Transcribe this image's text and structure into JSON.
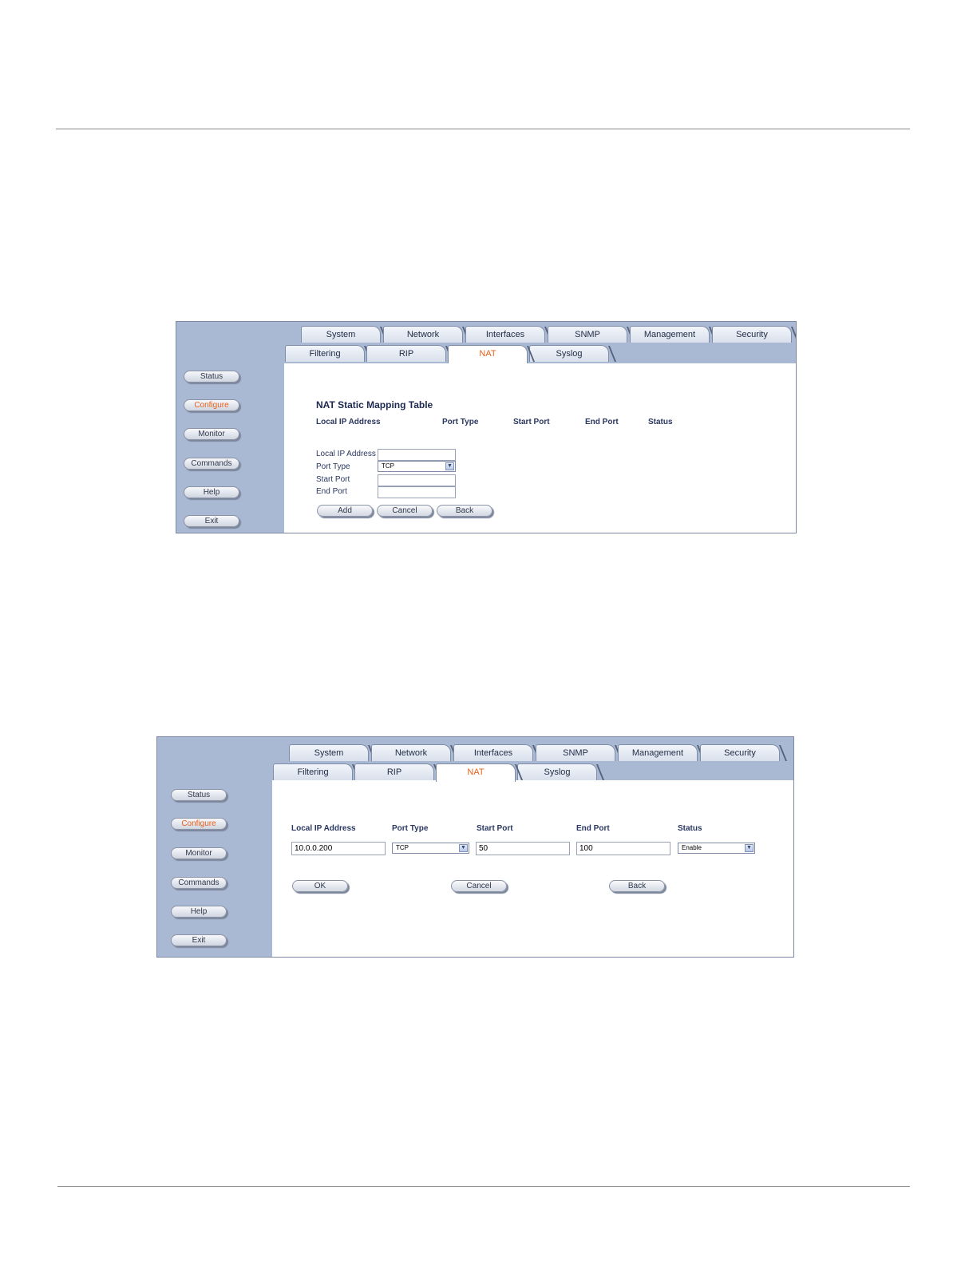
{
  "tabs_row1": [
    "System",
    "Network",
    "Interfaces",
    "SNMP",
    "Management",
    "Security"
  ],
  "tabs_row2": [
    "Filtering",
    "RIP",
    "NAT",
    "Syslog"
  ],
  "sidebar": [
    "Status",
    "Configure",
    "Monitor",
    "Commands",
    "Help",
    "Exit"
  ],
  "colors": {
    "frame_bg": "#aab9d3",
    "active": "#e8611a",
    "text": "#2a3760"
  },
  "screen1": {
    "title": "NAT Static Mapping Table",
    "columns": [
      "Local IP Address",
      "Port Type",
      "Start Port",
      "End Port",
      "Status"
    ],
    "form": {
      "local_ip_label": "Local IP Address",
      "port_type_label": "Port Type",
      "port_type_value": "TCP",
      "start_port_label": "Start Port",
      "end_port_label": "End Port"
    },
    "buttons": [
      "Add",
      "Cancel",
      "Back"
    ]
  },
  "screen2": {
    "columns": [
      "Local IP Address",
      "Port Type",
      "Start Port",
      "End Port",
      "Status"
    ],
    "values": {
      "local_ip": "10.0.0.200",
      "port_type": "TCP",
      "start_port": "50",
      "end_port": "100",
      "status": "Enable"
    },
    "buttons": [
      "OK",
      "Cancel",
      "Back"
    ]
  }
}
